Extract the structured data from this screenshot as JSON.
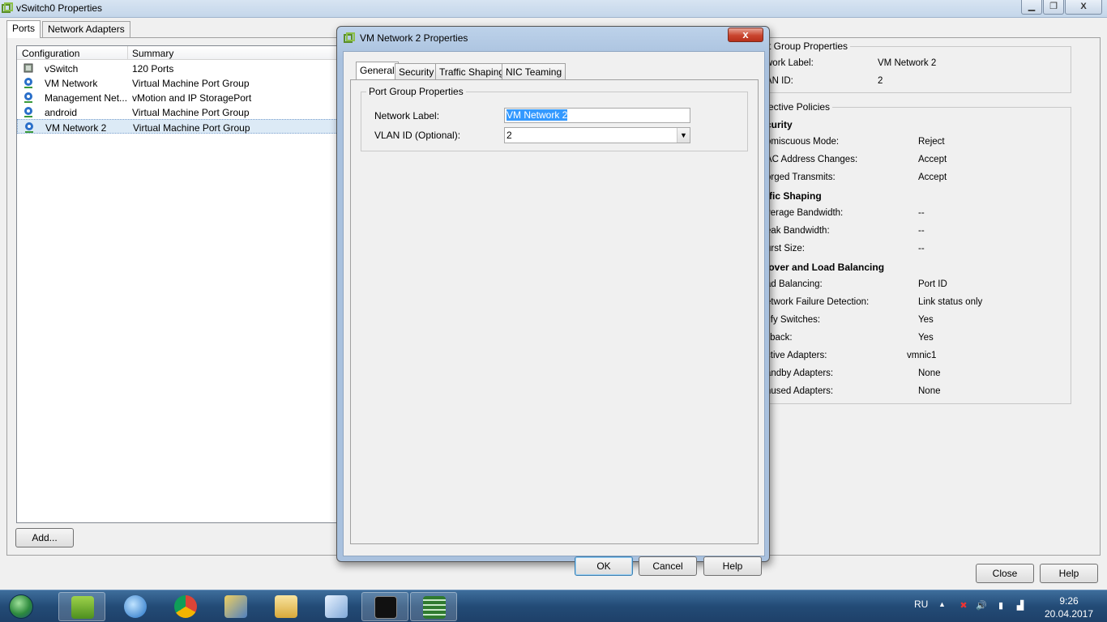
{
  "window": {
    "title": "vSwitch0 Properties",
    "min": "▁",
    "max": "❐",
    "close": "X"
  },
  "tabs": {
    "ports": "Ports",
    "network_adapters": "Network Adapters"
  },
  "list": {
    "headers": {
      "configuration": "Configuration",
      "summary": "Summary"
    },
    "rows": [
      {
        "config": "vSwitch",
        "summary": "120 Ports",
        "icon": "switch-icon"
      },
      {
        "config": "VM Network",
        "summary": "Virtual Machine Port Group",
        "icon": "port-group-icon"
      },
      {
        "config": "Management Net...",
        "summary": "vMotion and IP StoragePort",
        "icon": "port-group-icon"
      },
      {
        "config": "android",
        "summary": "Virtual Machine Port Group",
        "icon": "port-group-icon"
      },
      {
        "config": "VM Network 2",
        "summary": "Virtual Machine Port Group",
        "icon": "port-group-icon"
      }
    ]
  },
  "buttons": {
    "add": "Add...",
    "close": "Close",
    "help": "Help"
  },
  "right_panel": {
    "port_group_title": "t Group Properties",
    "network_label_key": "work Label:",
    "network_label_val": "VM Network 2",
    "vlan_key": "AN ID:",
    "vlan_val": "2",
    "effective_title": "ective Policies",
    "security_h": "curity",
    "promiscuous_key": "omiscuous Mode:",
    "promiscuous_val": "Reject",
    "mac_key": "AC Address Changes:",
    "mac_val": "Accept",
    "forged_key": "orged Transmits:",
    "forged_val": "Accept",
    "shaping_h": "ffic Shaping",
    "avg_key": "verage Bandwidth:",
    "avg_val": "--",
    "peak_key": "eak Bandwidth:",
    "peak_val": "--",
    "burst_key": "urst Size:",
    "burst_val": "--",
    "failover_h": "lover and Load Balancing",
    "lb_key": "ad Balancing:",
    "lb_val": "Port ID",
    "nfd_key": "etwork Failure Detection:",
    "nfd_val": "Link status only",
    "notify_key": "tify Switches:",
    "notify_val": "Yes",
    "failback_key": "ilback:",
    "failback_val": "Yes",
    "active_key": "ctive Adapters:",
    "active_val": "vmnic1",
    "standby_key": "andby Adapters:",
    "standby_val": "None",
    "unused_key": "nused Adapters:",
    "unused_val": "None"
  },
  "dialog": {
    "title": "VM Network 2 Properties",
    "close": "x",
    "tabs": {
      "general": "General",
      "security": "Security",
      "traffic": "Traffic Shaping",
      "nic": "NIC Teaming"
    },
    "group_title": "Port Group Properties",
    "network_label": "Network Label:",
    "network_label_value": "VM Network 2",
    "vlan_label": "VLAN ID (Optional):",
    "vlan_value": "2",
    "ok": "OK",
    "cancel": "Cancel",
    "help": "Help"
  },
  "taskbar": {
    "lang": "RU",
    "time": "9:26",
    "date": "20.04.2017",
    "apps": [
      "vsphere-client-icon",
      "thunderbird-icon",
      "chrome-icon",
      "network-tool-icon",
      "explorer-folder-icon",
      "notepad-icon",
      "cmd-icon",
      "server-rack-icon"
    ]
  }
}
